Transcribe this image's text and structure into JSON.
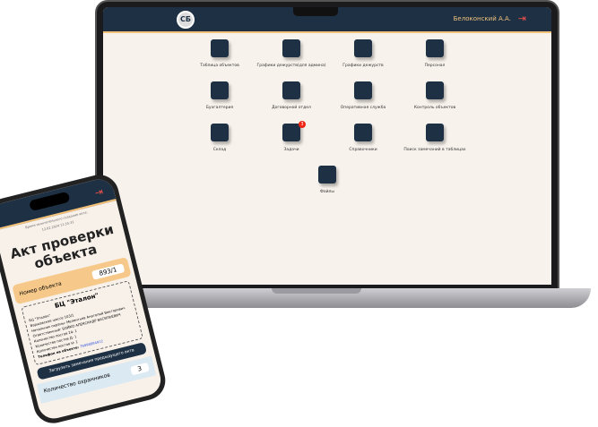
{
  "laptop": {
    "logo": "СБ",
    "user": "Белоконский А.А.",
    "tiles": [
      {
        "label": "Таблица объектов",
        "icon": "table-icon"
      },
      {
        "label": "Графики дежурств(для админа)",
        "icon": "calendar-icon"
      },
      {
        "label": "Графики дежурств",
        "icon": "calendar-icon"
      },
      {
        "label": "Персонал",
        "icon": "users-icon"
      },
      {
        "label": "Бухгалтерия",
        "icon": "building-icon"
      },
      {
        "label": "Договорной отдел",
        "icon": "chat-icon"
      },
      {
        "label": "Оперативная служба",
        "icon": "phone-icon"
      },
      {
        "label": "Контроль объектов",
        "icon": "people-arrows-icon"
      },
      {
        "label": "Склад",
        "icon": "warehouse-icon"
      },
      {
        "label": "Задачи",
        "icon": "calendar-check-icon",
        "badge": "3"
      },
      {
        "label": "Справочники",
        "icon": "book-icon"
      },
      {
        "label": "Поиск замечаний в таблицах",
        "icon": "bug-icon"
      },
      {
        "label": "Файлы",
        "icon": "file-icon"
      }
    ]
  },
  "phone": {
    "time_label": "Время окончательного создания акта:",
    "time": "12.02.2024 11:55:31",
    "title": "Акт проверки объекта",
    "object_number_label": "Номер объекта",
    "object_number": "893/1",
    "card_title": "БЦ \"Эталон\"",
    "lines": [
      "БЦ \"Эталон\"",
      "Варшавское шоссе 103/1",
      "Начальник охраны: Мелентьев Анатолий Викторович",
      "Ответственный: БОЙКО АЛЕКСАНДР ВАСИЛЬЕВИЧ",
      "Количество постов 24: 1",
      "Количество постов Д: 1",
      "Количество постов Н: 1"
    ],
    "phone_label": "Телефон на объекте:",
    "phone": "79998884912",
    "load_button": "Загрузить замечания предыдущего акта",
    "guards_label": "Количество охранников",
    "guards": "3"
  }
}
